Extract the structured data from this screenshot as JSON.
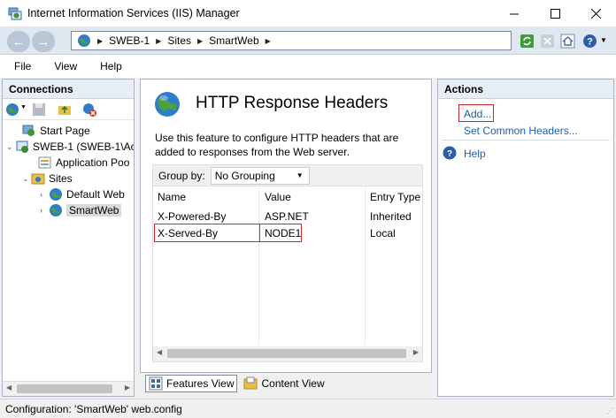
{
  "window": {
    "title": "Internet Information Services (IIS) Manager",
    "controls": {
      "minimize": "minimize-icon",
      "maximize": "maximize-icon",
      "close": "close-icon"
    }
  },
  "address": {
    "segments": [
      "SWEB-1",
      "Sites",
      "SmartWeb"
    ]
  },
  "menu": [
    "File",
    "View",
    "Help"
  ],
  "connections": {
    "title": "Connections",
    "tree": {
      "start_page": "Start Page",
      "server": "SWEB-1 (SWEB-1\\Ac",
      "app_pools": "Application Poo",
      "sites": "Sites",
      "default_site": "Default Web",
      "smartweb": "SmartWeb"
    }
  },
  "center": {
    "title": "HTTP Response Headers",
    "description": "Use this feature to configure HTTP headers that are added to responses from the Web server.",
    "group_by_label": "Group by:",
    "group_by_value": "No Grouping",
    "columns": [
      "Name",
      "Value",
      "Entry Type"
    ],
    "rows": [
      {
        "name": "X-Powered-By",
        "value": "ASP.NET",
        "type": "Inherited"
      },
      {
        "name": "X-Served-By",
        "value": "NODE1",
        "type": "Local"
      }
    ]
  },
  "views": {
    "features": "Features View",
    "content": "Content View"
  },
  "actions": {
    "title": "Actions",
    "add": "Add...",
    "set_common": "Set Common Headers...",
    "help": "Help"
  },
  "status": {
    "text": "Configuration: 'SmartWeb' web.config"
  },
  "colors": {
    "link": "#1a5fb4",
    "highlight": "#d0262c",
    "pane_header": "#e8eef5"
  }
}
